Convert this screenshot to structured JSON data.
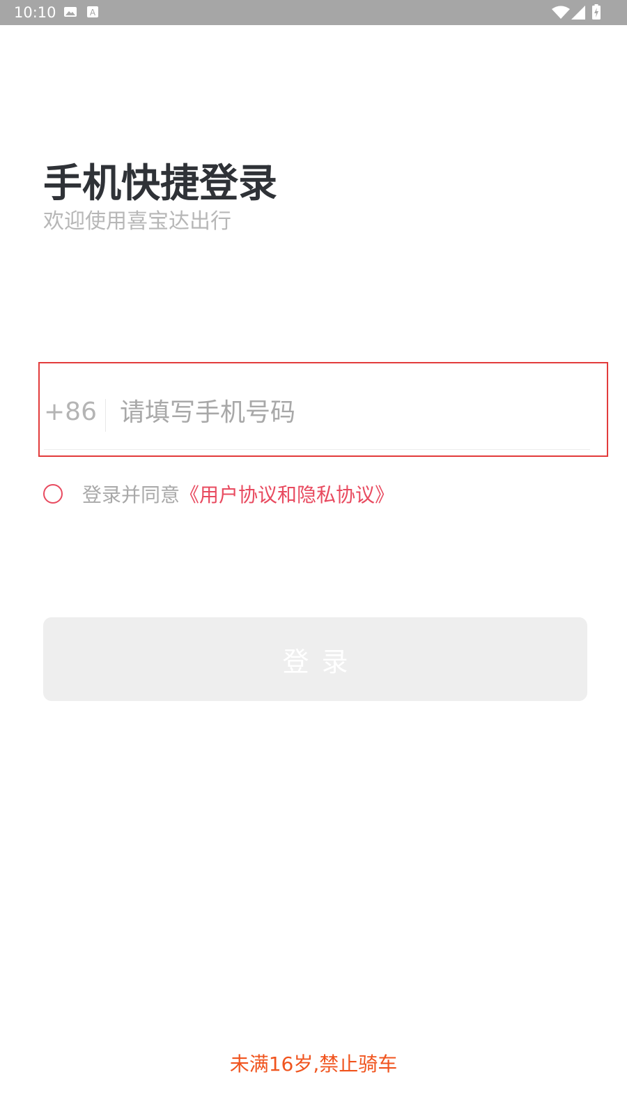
{
  "status_bar": {
    "time": "10:10",
    "icons": [
      "image-icon",
      "font-a-icon",
      "wifi-icon",
      "signal-icon",
      "battery-charging-icon"
    ]
  },
  "header": {
    "title": "手机快捷登录",
    "subtitle": "欢迎使用喜宝达出行"
  },
  "phone": {
    "country_code": "+86",
    "value": "",
    "placeholder": "请填写手机号码"
  },
  "agreement": {
    "checked": false,
    "prefix": "登录并同意",
    "link_text": "《用户协议和隐私协议》"
  },
  "login_button": {
    "label": "登录"
  },
  "footer": {
    "age_notice": "未满16岁,禁止骑车"
  },
  "colors": {
    "accent": "#e84a5f",
    "notice": "#f0541e",
    "status_bar": "#a6a6a6",
    "button_disabled": "#eeeeee",
    "title": "#2f3237"
  }
}
